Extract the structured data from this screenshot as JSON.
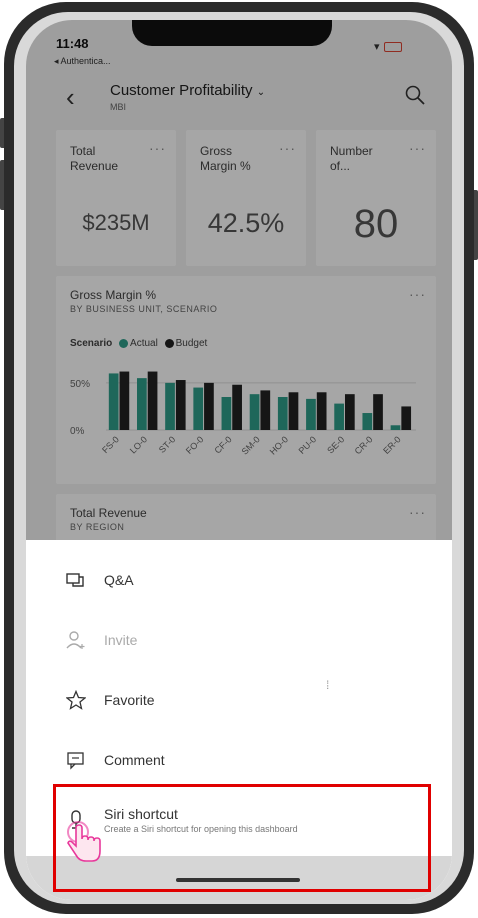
{
  "status": {
    "time": "11:48",
    "back_app": "◂ Authentica..."
  },
  "header": {
    "title": "Customer Profitability",
    "subtitle": "MBI"
  },
  "tiles": [
    {
      "title_line1": "Total",
      "title_line2": "Revenue",
      "value": "$235M"
    },
    {
      "title_line1": "Gross",
      "title_line2": "Margin %",
      "value": "42.5%"
    },
    {
      "title_line1": "Number",
      "title_line2": "of...",
      "value": "80"
    }
  ],
  "gross_chart": {
    "title": "Gross Margin %",
    "subtitle": "BY BUSINESS UNIT, SCENARIO",
    "legend_label": "Scenario",
    "ticks": [
      "50%",
      "0%"
    ]
  },
  "region_tile": {
    "title": "Total Revenue",
    "subtitle": "BY REGION"
  },
  "menu": {
    "qa": "Q&A",
    "invite": "Invite",
    "favorite": "Favorite",
    "comment": "Comment",
    "siri_title": "Siri shortcut",
    "siri_sub": "Create a Siri shortcut for opening this dashboard"
  },
  "colors": {
    "actual": "#2e9e8a",
    "budget": "#222222",
    "highlight": "#e00000"
  },
  "chart_data": {
    "type": "bar",
    "title": "Gross Margin %",
    "subtitle": "BY BUSINESS UNIT, SCENARIO",
    "categories": [
      "FS-0",
      "LO-0",
      "ST-0",
      "FO-0",
      "CF-0",
      "SM-0",
      "HO-0",
      "PU-0",
      "SE-0",
      "CR-0",
      "ER-0"
    ],
    "series": [
      {
        "name": "Actual",
        "values": [
          60,
          55,
          50,
          45,
          35,
          38,
          35,
          33,
          28,
          18,
          5
        ]
      },
      {
        "name": "Budget",
        "values": [
          62,
          62,
          53,
          50,
          48,
          42,
          40,
          40,
          38,
          38,
          25
        ]
      }
    ],
    "ylim": [
      0,
      70
    ],
    "yticks": [
      "50%",
      "0%"
    ],
    "legend_title": "Scenario"
  }
}
